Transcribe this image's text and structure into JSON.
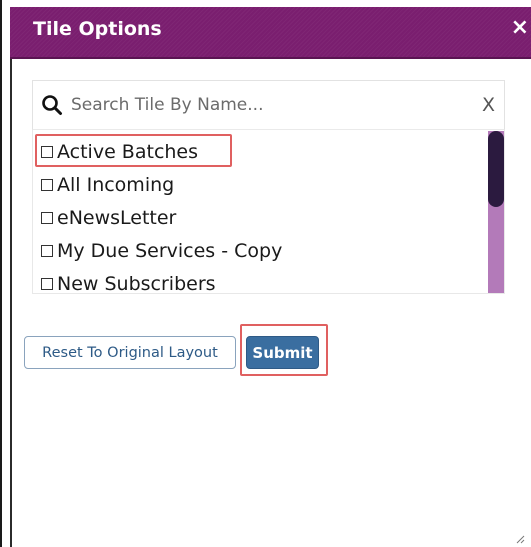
{
  "dialog": {
    "title": "Tile Options",
    "close_glyph": "×"
  },
  "search": {
    "placeholder": "Search Tile By Name...",
    "value": "",
    "clear_label": "X",
    "icon": "search-icon"
  },
  "tiles": [
    {
      "label": "Active Batches",
      "checked": false
    },
    {
      "label": "All Incoming",
      "checked": false
    },
    {
      "label": "eNewsLetter",
      "checked": false
    },
    {
      "label": "My Due Services - Copy",
      "checked": false
    },
    {
      "label": "New Subscribers",
      "checked": false
    }
  ],
  "buttons": {
    "reset_label": "Reset To Original Layout",
    "submit_label": "Submit"
  },
  "colors": {
    "header": "#7a1e6f",
    "submit": "#3a6ea0",
    "highlight": "#e06060",
    "scroll_track": "#b37ab9",
    "scroll_thumb": "#2b1a3f"
  }
}
